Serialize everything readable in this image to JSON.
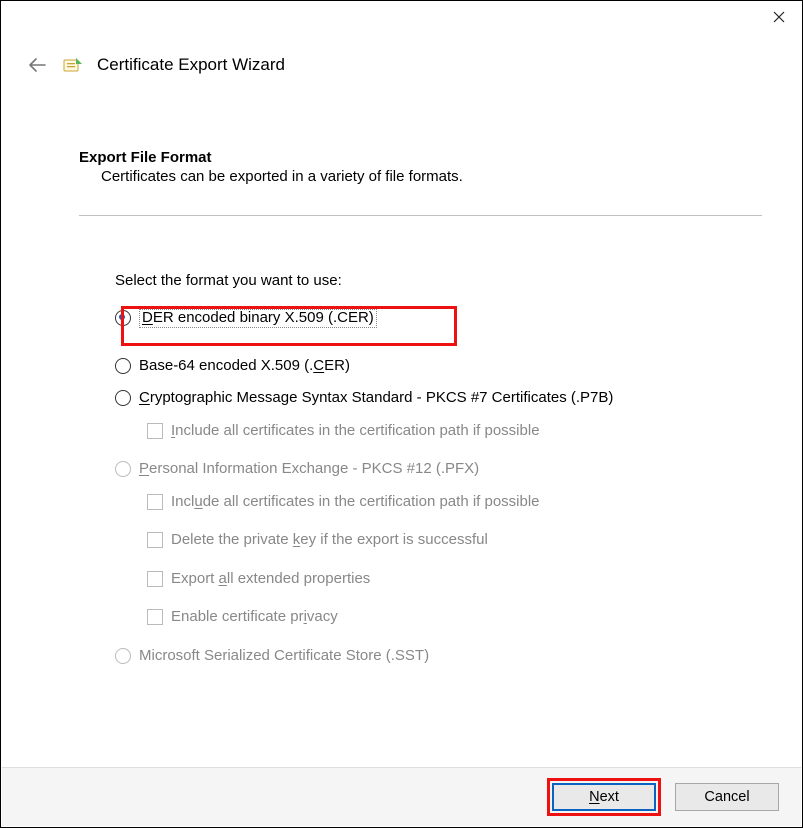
{
  "window": {
    "title": "Certificate Export Wizard"
  },
  "section": {
    "title": "Export File Format",
    "subtitle": "Certificates can be exported in a variety of file formats."
  },
  "prompt": "Select the format you want to use:",
  "options": {
    "der": {
      "pre": "",
      "u": "D",
      "post": "ER encoded binary X.509 (.CER)"
    },
    "base64": {
      "pre": "Base-64 encoded X.509 (.",
      "u": "C",
      "post": "ER)"
    },
    "pkcs7": {
      "pre": "",
      "u": "C",
      "post": "ryptographic Message Syntax Standard - PKCS #7 Certificates (.P7B)"
    },
    "pkcs7inc": {
      "pre": "",
      "u": "I",
      "post": "nclude all certificates in the certification path if possible"
    },
    "pfx": {
      "pre": "",
      "u": "P",
      "post": "ersonal Information Exchange - PKCS #12 (.PFX)"
    },
    "pfxinc": {
      "pre": "Incl",
      "u": "u",
      "post": "de all certificates in the certification path if possible"
    },
    "pfxdel": {
      "pre": "Delete the private ",
      "u": "k",
      "post": "ey if the export is successful"
    },
    "pfxext": {
      "pre": "Export ",
      "u": "a",
      "post": "ll extended properties"
    },
    "pfxpriv": {
      "pre": "Enable certificate pr",
      "u": "i",
      "post": "vacy"
    },
    "sst": {
      "text": "Microsoft Serialized Certificate Store (.SST)"
    }
  },
  "buttons": {
    "next": {
      "u": "N",
      "post": "ext"
    },
    "cancel": {
      "text": "Cancel"
    }
  }
}
